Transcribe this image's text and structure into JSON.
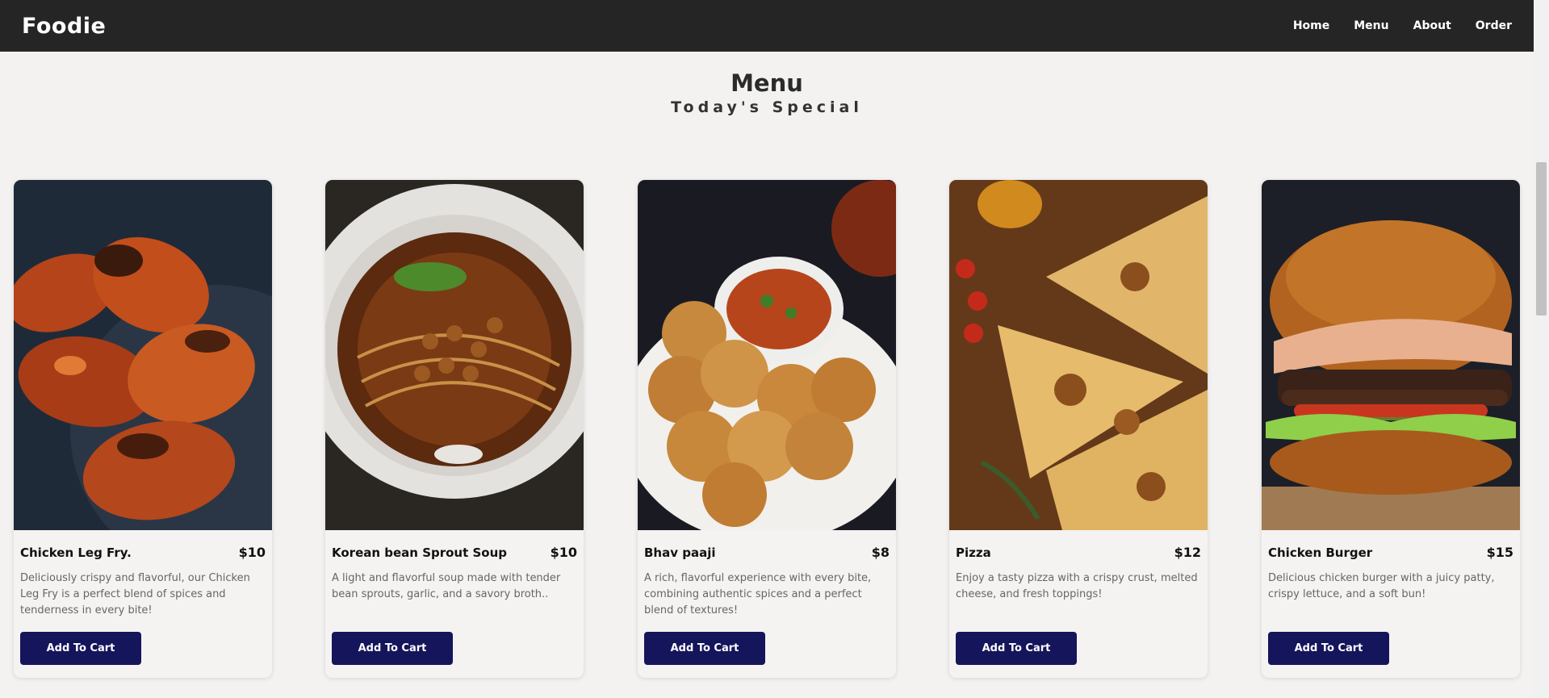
{
  "navbar": {
    "brand": "Foodie",
    "links": [
      "Home",
      "Menu",
      "About",
      "Order"
    ]
  },
  "heading": {
    "title": "Menu",
    "subtitle": "Today's Special"
  },
  "cards": [
    {
      "name": "Chicken Leg Fry.",
      "price": "$10",
      "description": "Deliciously crispy and flavorful, our Chicken Leg Fry is a perfect blend of spices and tenderness in every bite!",
      "button": "Add To Cart"
    },
    {
      "name": "Korean bean Sprout Soup",
      "price": "$10",
      "description": "A light and flavorful soup made with tender bean sprouts, garlic, and a savory broth..",
      "button": "Add To Cart"
    },
    {
      "name": "Bhav paaji",
      "price": "$8",
      "description": "A rich, flavorful experience with every bite, combining authentic spices and a perfect blend of textures!",
      "button": "Add To Cart"
    },
    {
      "name": "Pizza",
      "price": "$12",
      "description": "Enjoy a tasty pizza with a crispy crust, melted cheese, and fresh toppings!",
      "button": "Add To Cart"
    },
    {
      "name": "Chicken Burger",
      "price": "$15",
      "description": "Delicious chicken burger with a juicy patty, crispy lettuce, and a soft bun!",
      "button": "Add To Cart"
    }
  ],
  "colors": {
    "navbar": "#252525",
    "button": "#15155c",
    "background": "#f3f2f1"
  }
}
